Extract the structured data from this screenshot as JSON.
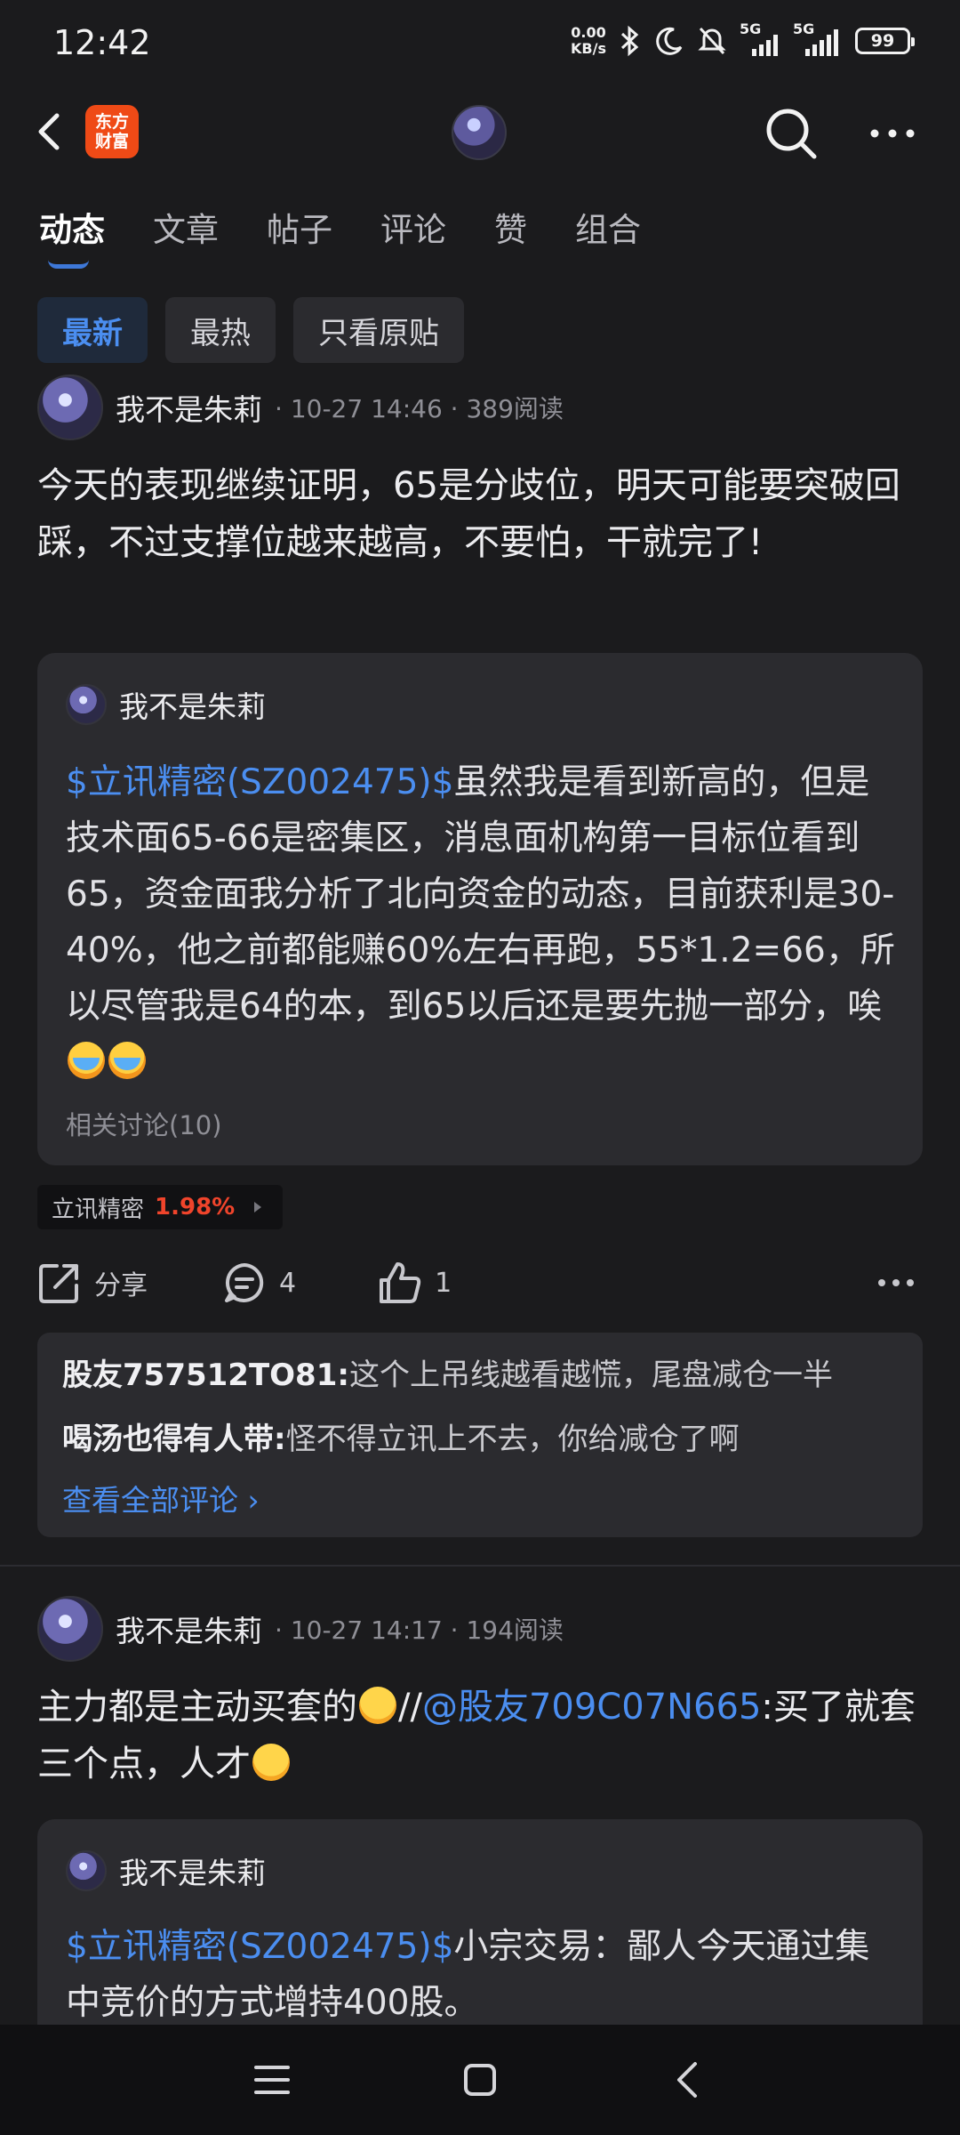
{
  "status_bar": {
    "time": "12:42",
    "net_speed_value": "0.00",
    "net_speed_unit": "KB/s",
    "signal_1": "5G",
    "signal_2": "5G",
    "battery": "99"
  },
  "header": {
    "logo_line1": "东方",
    "logo_line2": "财富"
  },
  "tabs": [
    "动态",
    "文章",
    "帖子",
    "评论",
    "赞",
    "组合"
  ],
  "filters": [
    "最新",
    "最热",
    "只看原贴"
  ],
  "posts": [
    {
      "author": "我不是朱莉",
      "time": "10-27 14:46",
      "reads": "389阅读",
      "text": "今天的表现继续证明，65是分歧位，明天可能要突破回踩，不过支撑位越来越高，不要怕，干就完了!",
      "quote": {
        "author": "我不是朱莉",
        "stock_link": "$立讯精密(SZ002475)$",
        "text": "虽然我是看到新高的，但是技术面65-66是密集区，消息面机构第一目标位看到65，资金面我分析了北向资金的动态，目前获利是30-40%，他之前都能赚60%左右再跑，55*1.2=66，所以尽管我是64的本，到65以后还是要先抛一部分，唉",
        "related": "相关讨论(10)"
      },
      "stock_tag": {
        "name": "立讯精密",
        "change": "1.98%"
      },
      "actions": {
        "share": "分享",
        "comments": "4",
        "likes": "1"
      },
      "comments": [
        {
          "user": "股友757512TO81:",
          "text": "这个上吊线越看越慌，尾盘减仓一半"
        },
        {
          "user": "喝汤也得有人带:",
          "text": "怪不得立讯上不去，你给减仓了啊"
        }
      ],
      "view_all": "查看全部评论 ›"
    },
    {
      "author": "我不是朱莉",
      "time": "10-27 14:17",
      "reads": "194阅读",
      "text_part1": "主力都是主动买套的",
      "text_part2": "//",
      "mention": "@股友709C07N665",
      "text_part3": ":买了就套三个点，人才",
      "quote": {
        "author": "我不是朱莉",
        "stock_link": "$立讯精密(SZ002475)$",
        "text": "小宗交易：鄙人今天通过集中竞价的方式增持400股。"
      }
    }
  ],
  "colors": {
    "background": "#1b1b1d",
    "card": "#2b2b2f",
    "accent_blue": "#4b8ef0",
    "up_red": "#f0442b",
    "logo_orange": "#ef4a16"
  },
  "icons": [
    "back-icon",
    "search-icon",
    "more-icon",
    "share-icon",
    "comment-icon",
    "like-icon",
    "menu-icon",
    "home-icon",
    "back-nav-icon"
  ]
}
